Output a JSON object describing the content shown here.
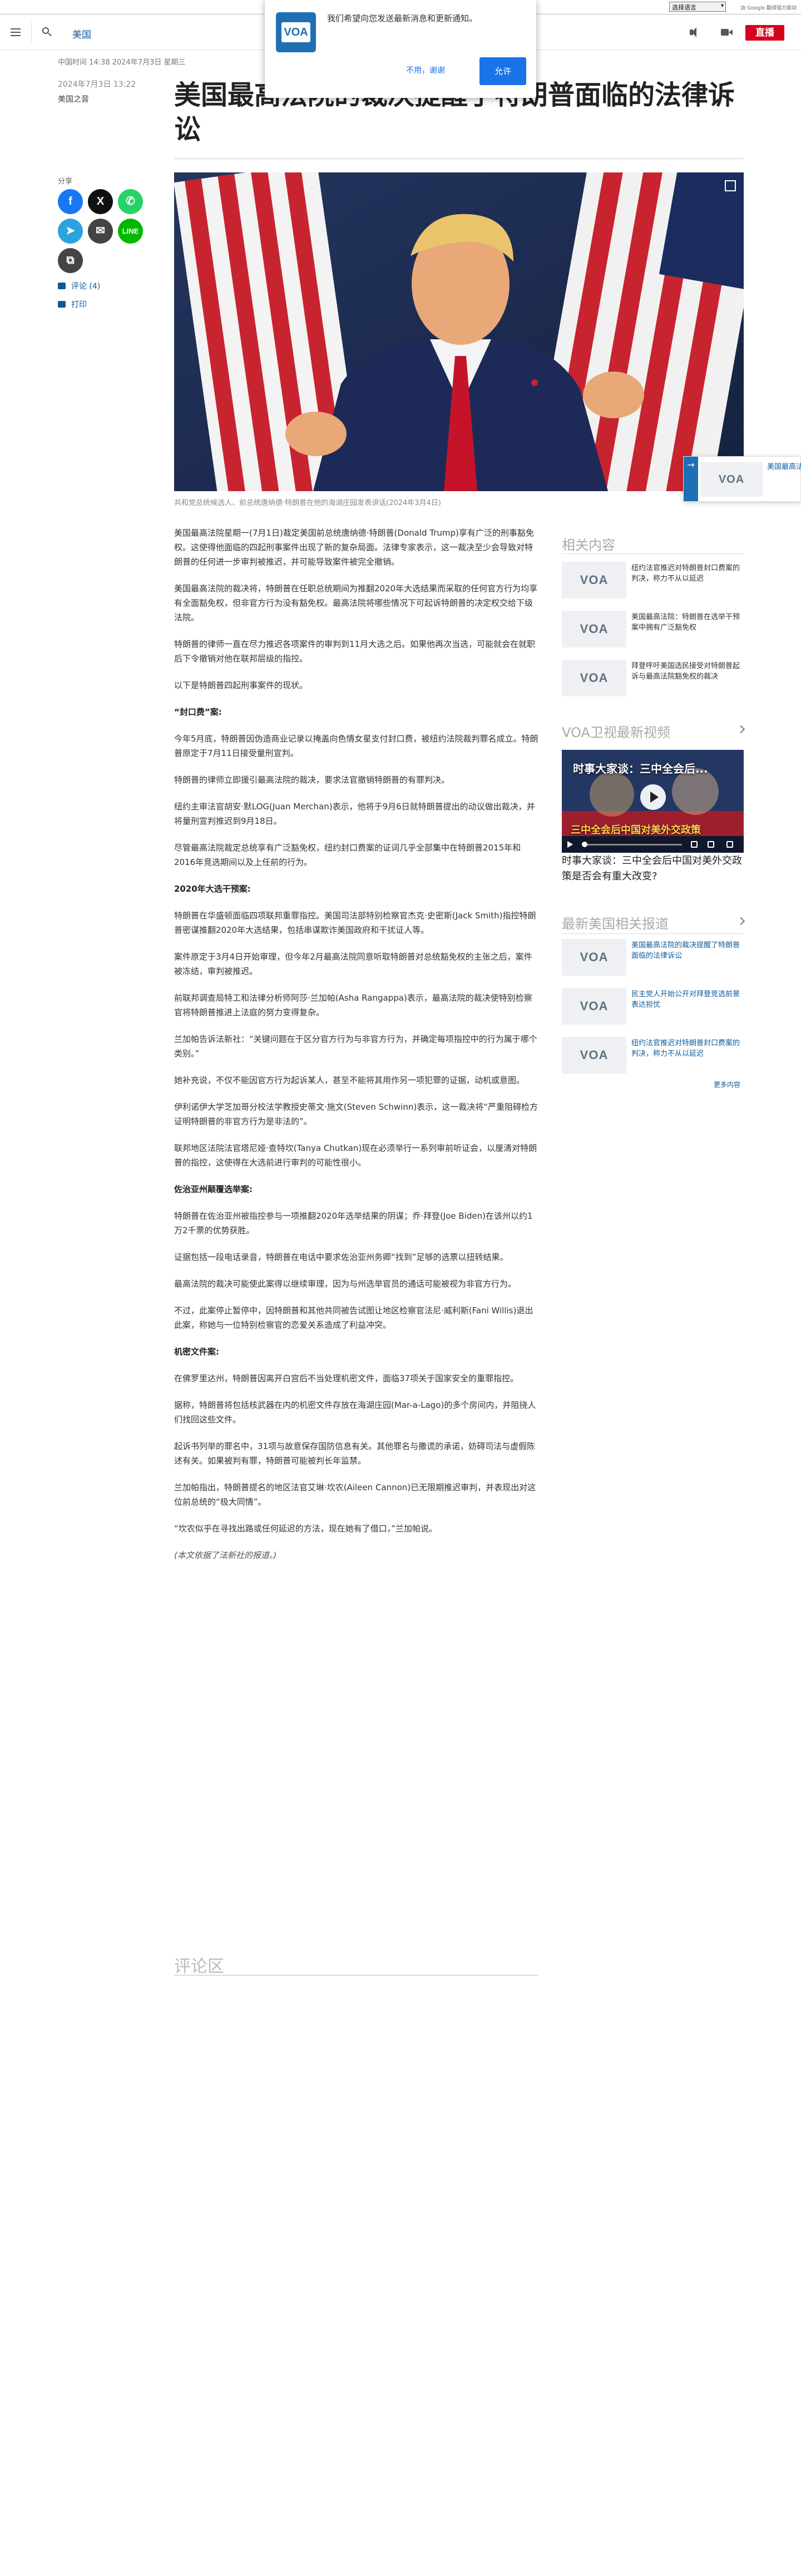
{
  "translate": {
    "select_label": "选择语言",
    "powered": "由 Google 翻译强力驱动"
  },
  "header": {
    "section": "美国",
    "live": "直播"
  },
  "notification": {
    "message": "我们希望向您发送最新消息和更新通知。",
    "deny": "不用，谢谢",
    "allow": "允许"
  },
  "meta": {
    "datestamp": "中国时间 14:38 2024年7月3日 星期三",
    "published": "2024年7月3日 13:22",
    "author": "美国之音"
  },
  "article": {
    "title": "美国最高法院的裁决提醒了特朗普面临的法律诉讼",
    "caption": "共和党总统候选人、前总统唐纳德·特朗普在他的海湖庄园发表讲话(2024年3月4日)",
    "paragraphs": [
      {
        "text": "美国最高法院星期一(7月1日)裁定美国前总统唐纳德·特朗普(Donald Trump)享有广泛的刑事豁免权。这使得他面临的四起刑事案件出现了新的复杂局面。法律专家表示，这一裁决至少会导致对特朗普的任何进一步审判被推迟，并可能导致案件被完全撤销。",
        "style": "p"
      },
      {
        "text": "美国最高法院的裁决将，特朗普在任职总统期间为推翻2020年大选结果而采取的任何官方行为均享有全面豁免权，但非官方行为没有豁免权。最高法院将哪些情况下可起诉特朗普的决定权交给下级法院。",
        "style": "p"
      },
      {
        "text": "特朗普的律师一直在尽力推迟各项案件的审判到11月大选之后。如果他再次当选，可能就会在就职后下令撤销对他在联邦层级的指控。",
        "style": "p"
      },
      {
        "text": "以下是特朗普四起刑事案件的现状。",
        "style": "p"
      },
      {
        "text": "“封口费”案:",
        "style": "sub"
      },
      {
        "text": "今年5月底，特朗普因伪造商业记录以掩盖向色情女星支付封口费，被纽约法院裁判罪名成立。特朗普原定于7月11日接受量刑宣判。",
        "style": "p"
      },
      {
        "text": "特朗普的律师立即援引最高法院的裁决，要求法官撤销特朗普的有罪判决。",
        "style": "p"
      },
      {
        "text": "纽约主审法官胡安·默LOG(Juan Merchan)表示，他将于9月6日就特朗普提出的动议做出裁决，并将量刑宣判推迟到9月18日。",
        "style": "p"
      },
      {
        "text": "尽管最高法院裁定总统享有广泛豁免权，纽约封口费案的证词几乎全部集中在特朗普2015年和2016年竞选期间以及上任前的行为。",
        "style": "p"
      },
      {
        "text": "2020年大选干预案:",
        "style": "sub"
      },
      {
        "text": "特朗普在华盛顿面临四项联邦重罪指控。美国司法部特别检察官杰克·史密斯(Jack Smith)指控特朗普密谋推翻2020年大选结果，包括串谋欺诈美国政府和干扰证人等。",
        "style": "p"
      },
      {
        "text": "案件原定于3月4日开始审理，但今年2月最高法院同意听取特朗普对总统豁免权的主张之后，案件被冻结，审判被推迟。",
        "style": "p"
      },
      {
        "text": "前联邦调查局特工和法律分析师阿莎·兰加帕(Asha Rangappa)表示，最高法院的裁决使特别检察官将特朗普推进上法庭的努力变得复杂。",
        "style": "p"
      },
      {
        "text": "兰加帕告诉法新社：“关键问题在于区分官方行为与非官方行为，并确定每项指控中的行为属于哪个类别。”",
        "style": "p"
      },
      {
        "text": "她补充说，不仅不能因官方行为起诉某人，甚至不能将其用作另一项犯罪的证据，动机或意图。",
        "style": "p"
      },
      {
        "text": "伊利诺伊大学芝加哥分校法学教授史蒂文·施文(Steven Schwinn)表示，这一裁决将“严重阻碍检方证明特朗普的非官方行为是非法的”。",
        "style": "p"
      },
      {
        "text": "联邦地区法院法官塔尼娅·查特坎(Tanya Chutkan)现在必须举行一系列审前听证会，以厘清对特朗普的指控，这使得在大选前进行审判的可能性很小。",
        "style": "p"
      },
      {
        "text": "佐治亚州颠覆选举案:",
        "style": "sub"
      },
      {
        "text": "特朗普在佐治亚州被指控参与一项推翻2020年选举结果的阴谋；乔·拜登(Joe Biden)在该州以约1万2千票的优势获胜。",
        "style": "p"
      },
      {
        "text": "证据包括一段电话录音，特朗普在电话中要求佐治亚州务卿“找到”足够的选票以扭转结果。",
        "style": "p"
      },
      {
        "text": "最高法院的裁决可能使此案得以继续审理，因为与州选举官员的通话可能被视为非官方行为。",
        "style": "p"
      },
      {
        "text": "不过，此案停止暂停中，因特朗普和其他共同被告试图让地区检察官法尼·威利斯(Fani Willis)退出此案，称她与一位特别检察官的恋爱关系造成了利益冲突。",
        "style": "p"
      },
      {
        "text": "机密文件案:",
        "style": "sub"
      },
      {
        "text": "在佛罗里达州，特朗普因离开白宫后不当处理机密文件，面临37项关于国家安全的重罪指控。",
        "style": "p"
      },
      {
        "text": "据称，特朗普将包括核武器在内的机密文件存放在海湖庄园(Mar-a-Lago)的多个房间内，并阻挠人们找回这些文件。",
        "style": "p"
      },
      {
        "text": "起诉书列举的罪名中，31项与故意保存国防信息有关。其他罪名与撒谎的承诺，妨碍司法与虚假陈述有关。如果被判有罪，特朗普可能被判长年监禁。",
        "style": "p"
      },
      {
        "text": "兰加帕指出，特朗普提名的地区法官艾琳·坎农(Aileen Cannon)已无限期推迟审判，并表现出对这位前总统的“极大同情”。",
        "style": "p"
      },
      {
        "text": "“坎农似乎在寻找出路或任何延迟的方法，现在她有了借口，”兰加帕说。",
        "style": "p"
      },
      {
        "text": "(本文依据了法新社的报道。)",
        "style": "note"
      }
    ],
    "comments_heading": "评论区"
  },
  "share": {
    "label": "分享",
    "comments": "评论 (4)",
    "print": "打印"
  },
  "float_player": {
    "title": "美国最高法院的裁决提醒了特朗普面临的法律诉讼"
  },
  "sidebar": {
    "related_heading": "相关内容",
    "related": [
      {
        "title": "纽约法官推迟对特朗普封口费案的判决，称力不从以延迟"
      },
      {
        "title": "美国最高法院：特朗普在选举干预案中拥有广泛豁免权"
      },
      {
        "title": "拜登呼吁美国选民接受对特朗普起诉与最高法院豁免权的裁决"
      }
    ],
    "video_heading": "VOA卫视最新视频",
    "video_overlay_top": "时事大家谈：三中全会后...",
    "video_overlay_bottom": "三中全会后中国对美外交政策",
    "video_title": "时事大家谈：三中全会后中国对美外交政策是否会有重大改变?",
    "latest_heading": "最新美国相关报道",
    "latest": [
      {
        "title": "美国最高法院的裁决提醒了特朗普面临的法律诉讼"
      },
      {
        "title": "民主党人开始公开对拜登竞选前景表达担忧"
      },
      {
        "title": "纽约法官推迟对特朗普封口费案的判决，称力不从以延迟"
      }
    ],
    "more": "更多内容"
  },
  "colors": {
    "accent": "#0b5b9c",
    "live": "#d6001c",
    "voa": "#1f6fb5"
  }
}
